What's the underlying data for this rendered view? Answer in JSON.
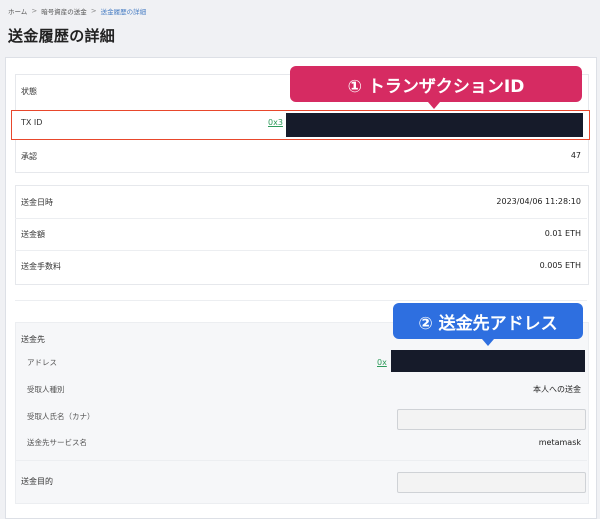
{
  "breadcrumb": {
    "items": [
      "ホーム",
      "暗号資産の送金",
      "送金履歴の詳細"
    ],
    "separator": ">"
  },
  "page_title": "送金履歴の詳細",
  "details": {
    "status_label": "状態",
    "txid_label": "TX ID",
    "txid_prefix": "0x3",
    "confirmations_label": "承認",
    "confirmations_value": "47",
    "sent_at_label": "送金日時",
    "sent_at_value": "2023/04/06 11:28:10",
    "amount_label": "送金額",
    "amount_value": "0.01 ETH",
    "fee_label": "送金手数料",
    "fee_value": "0.005 ETH"
  },
  "destination": {
    "section_label": "送金先",
    "address_label": "アドレス",
    "address_prefix": "0x",
    "recipient_type_label": "受取人種別",
    "recipient_type_value": "本人への送金",
    "recipient_name_label": "受取人氏名（カナ）",
    "service_label": "送金先サービス名",
    "service_value": "metamask",
    "purpose_label": "送金目的"
  },
  "callouts": {
    "txid": "① トランザクションID",
    "address": "② 送金先アドレス"
  },
  "colors": {
    "highlight_border": "#e8472c",
    "callout_1": "#d62b62",
    "callout_2": "#2e6fe0",
    "link": "#2d9b5a",
    "redaction": "#161b2a"
  }
}
